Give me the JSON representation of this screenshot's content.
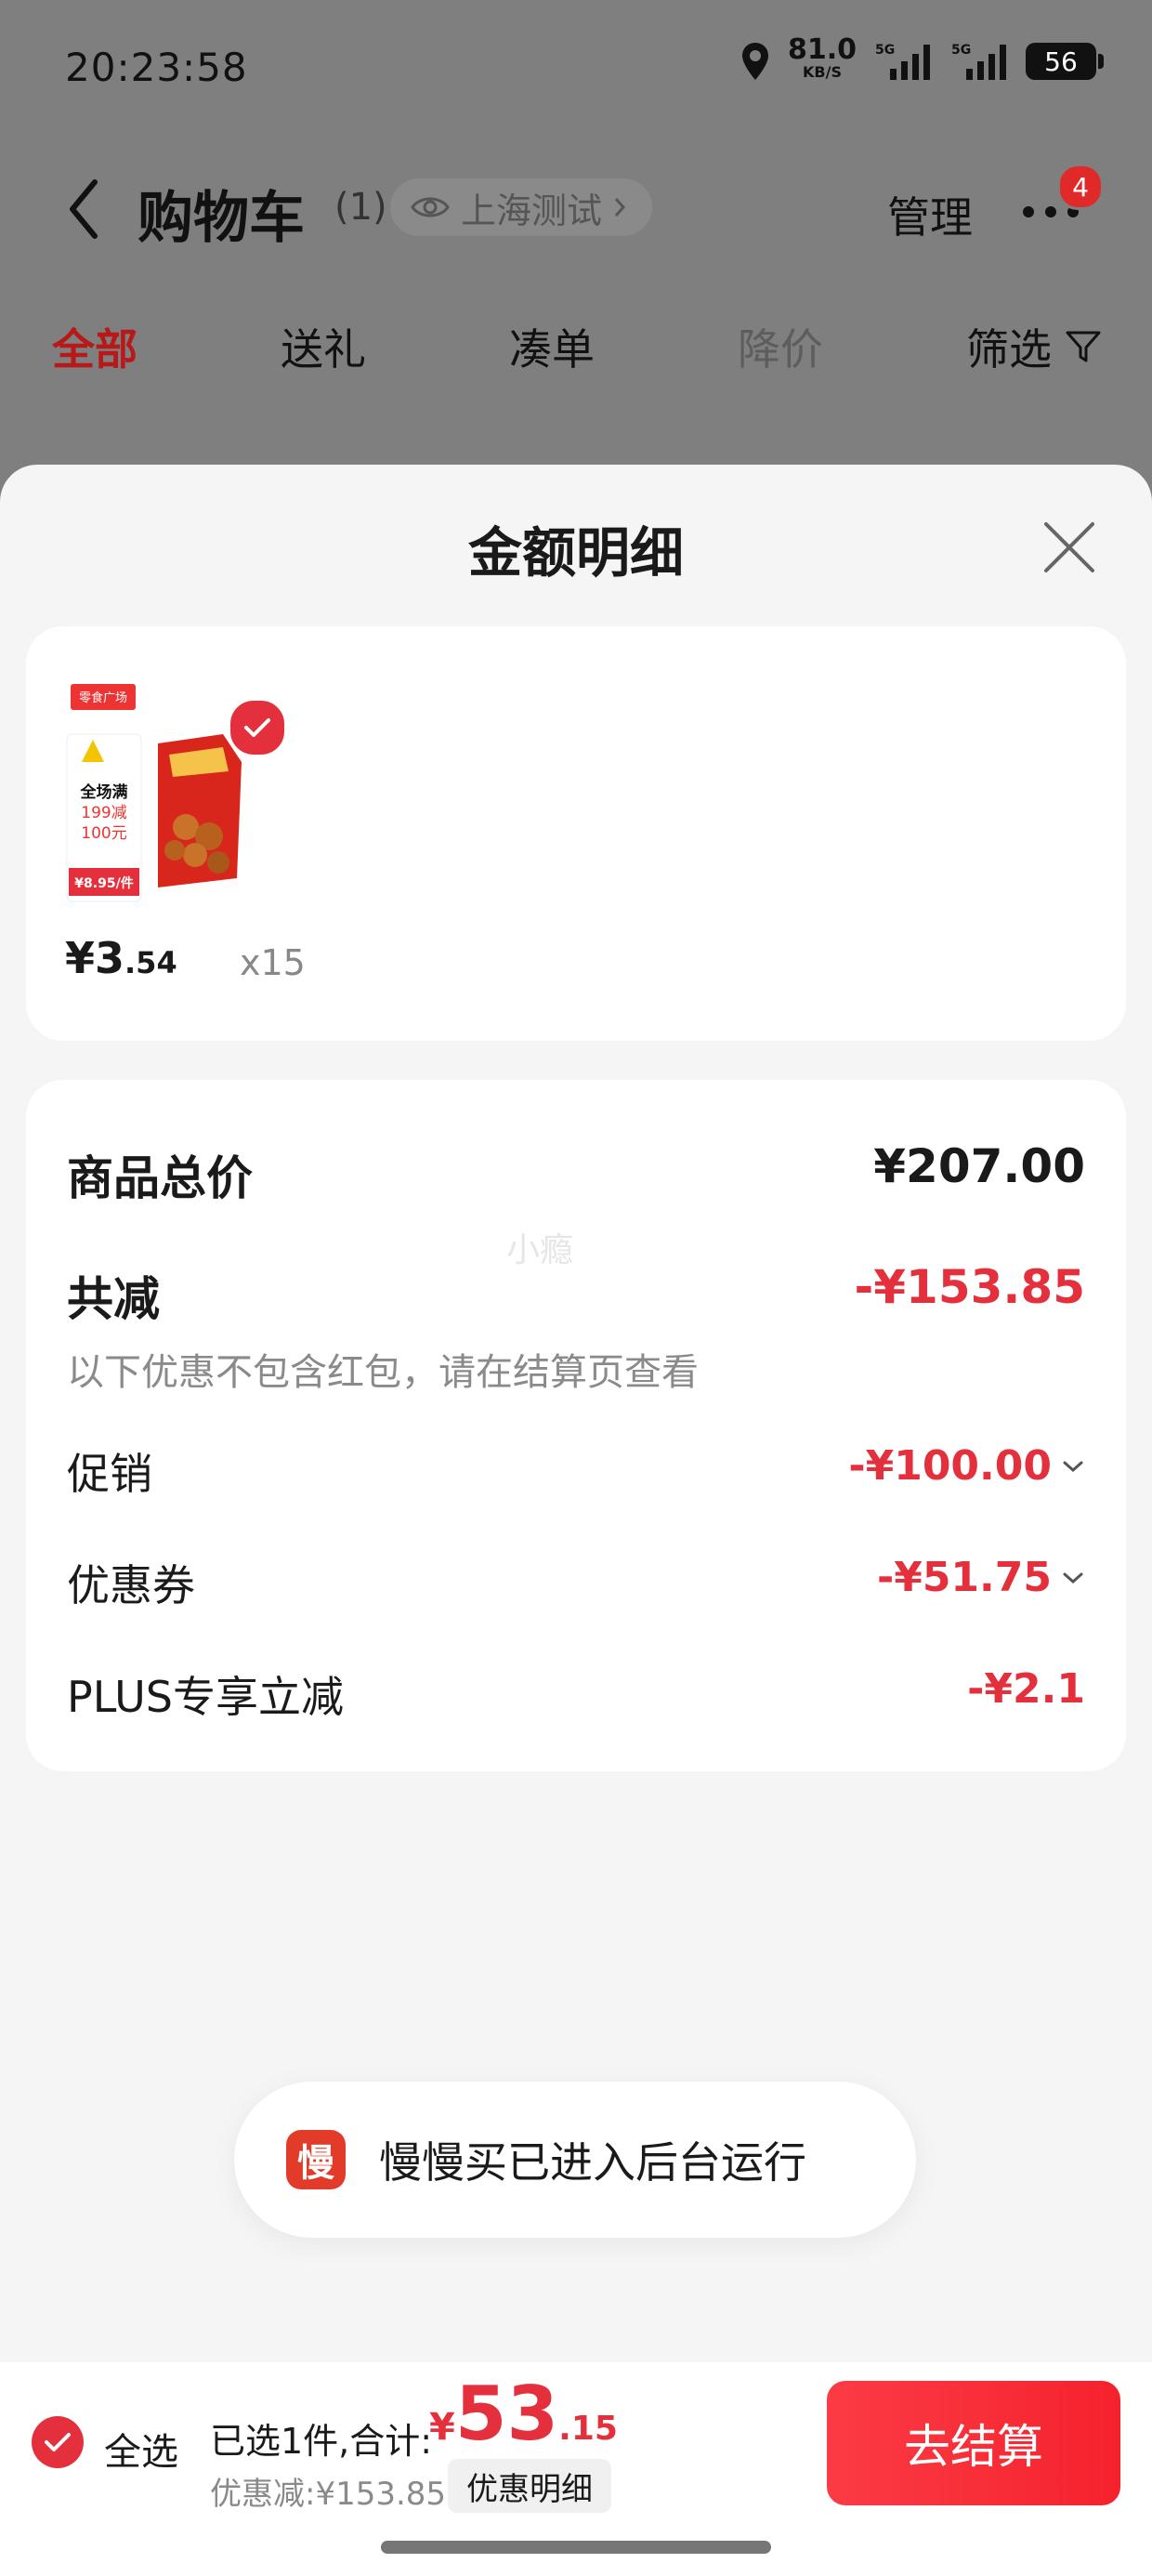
{
  "status_bar": {
    "time": "20:23:58",
    "net_speed": "81.0",
    "net_unit": "KB/S",
    "signal1": "5G",
    "signal2": "5G",
    "battery": "56"
  },
  "header": {
    "title": "购物车",
    "count": "(1)",
    "location": "上海测试",
    "manage": "管理",
    "more_badge": "4"
  },
  "tabs": [
    "全部",
    "送礼",
    "凑单",
    "降价",
    "筛选"
  ],
  "sheet": {
    "title": "金额明细",
    "product": {
      "package_text": [
        "零食广场",
        "全场满",
        "199减",
        "100元",
        "¥8.95/件"
      ],
      "price_int": "¥3",
      "price_dec": ".54",
      "quantity": "x15"
    },
    "summary": {
      "total_label": "商品总价",
      "total_value": "¥207.00",
      "watermark": "小瘾",
      "reduce_label": "共减",
      "reduce_value": "-¥153.85",
      "note": "以下优惠不包含红包，请在结算页查看",
      "items": [
        {
          "label": "促销",
          "value": "-¥100.00"
        },
        {
          "label": "优惠券",
          "value": "-¥51.75"
        },
        {
          "label": "PLUS专享立减",
          "value": "-¥2.1"
        }
      ]
    }
  },
  "toast": {
    "icon_char": "慢",
    "text": "慢慢买已进入后台运行"
  },
  "bottom_bar": {
    "select_all": "全选",
    "summary_prefix": "已选1件,合计:",
    "currency": "¥",
    "amount_int": "53",
    "amount_dec": ".15",
    "discount": "优惠减:¥153.85",
    "detail_button": "优惠明细",
    "checkout": "去结算"
  },
  "colors": {
    "accent_red": "#e4303c",
    "dim_overlay": "#7f7f7f"
  }
}
